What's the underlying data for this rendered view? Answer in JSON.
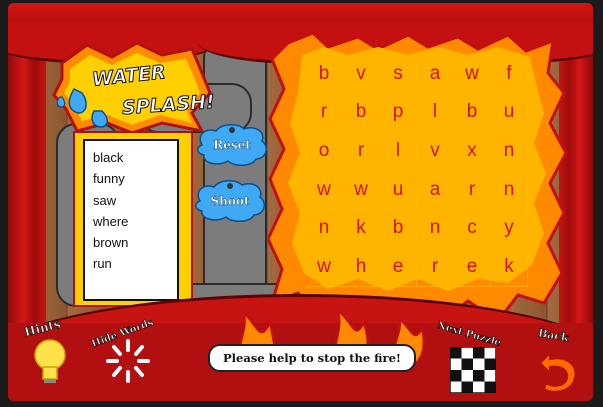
{
  "logo": {
    "line1": "WATER",
    "line2": "SPLASH!"
  },
  "word_list": [
    "black",
    "funny",
    "saw",
    "where",
    "brown",
    "run"
  ],
  "buttons": {
    "reset": "Reset",
    "shoot": "Shoot"
  },
  "grid": [
    [
      "b",
      "v",
      "s",
      "a",
      "w",
      "f"
    ],
    [
      "r",
      "b",
      "p",
      "l",
      "b",
      "u"
    ],
    [
      "o",
      "r",
      "l",
      "v",
      "x",
      "n"
    ],
    [
      "w",
      "w",
      "u",
      "a",
      "r",
      "n"
    ],
    [
      "n",
      "k",
      "b",
      "n",
      "c",
      "y"
    ],
    [
      "w",
      "h",
      "e",
      "r",
      "e",
      "k"
    ]
  ],
  "controls": {
    "hints": "Hints",
    "hide_words": "Hide Words",
    "next_puzzle": "Next Puzzle",
    "back": "Back"
  },
  "status_message": "Please help to stop the fire!",
  "colors": {
    "curtain": "#c81313",
    "fire_orange": "#ff8a00",
    "grid_letter": "#d21414",
    "word_panel": "#ffcf00"
  }
}
